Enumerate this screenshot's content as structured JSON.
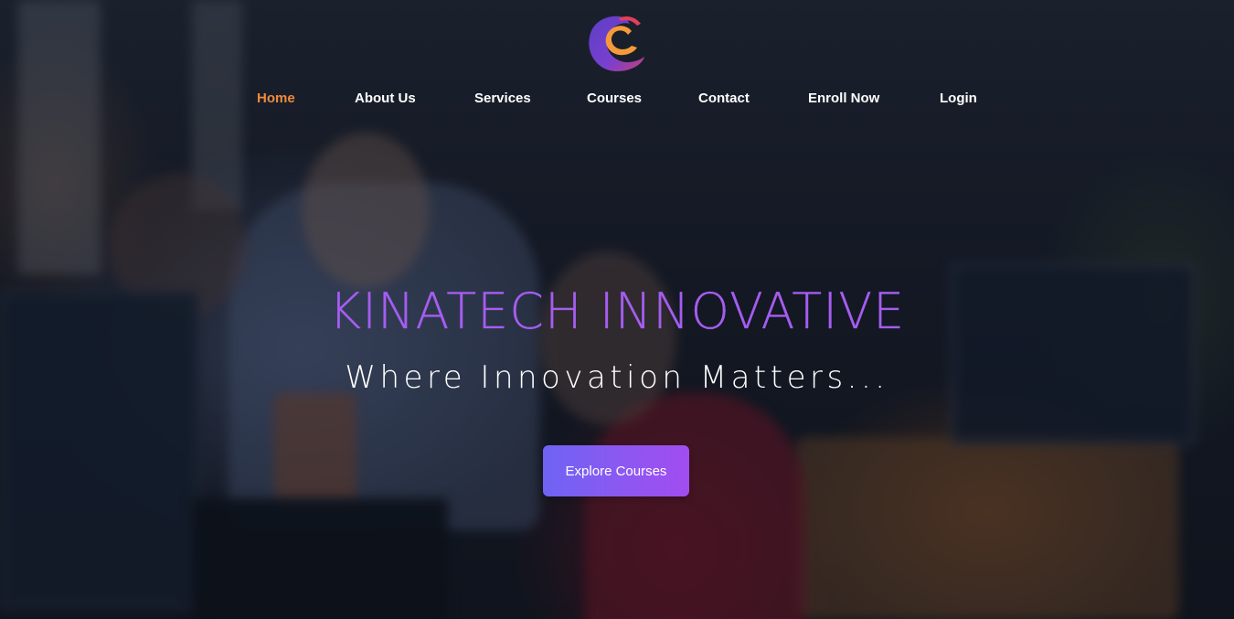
{
  "brand": {
    "logo_icon": "c-swirl-logo-icon",
    "colors": {
      "accent_purple": "#a55df0",
      "accent_orange": "#f08a3c",
      "logo_orange": "#f59a3a",
      "logo_purple": "#7a3fd0",
      "logo_red": "#e0405a"
    }
  },
  "nav": {
    "items": [
      {
        "label": "Home",
        "active": true
      },
      {
        "label": "About Us",
        "active": false
      },
      {
        "label": "Services",
        "active": false
      },
      {
        "label": "Courses",
        "active": false
      },
      {
        "label": "Contact",
        "active": false
      },
      {
        "label": "Enroll Now",
        "active": false
      },
      {
        "label": "Login",
        "active": false
      }
    ]
  },
  "hero": {
    "title": "KINATECH INNOVATIVE",
    "subtitle": "Where Innovation Matters...",
    "cta_label": "Explore Courses",
    "cta_gradient": [
      "#6f63f3",
      "#a24cf0"
    ]
  }
}
